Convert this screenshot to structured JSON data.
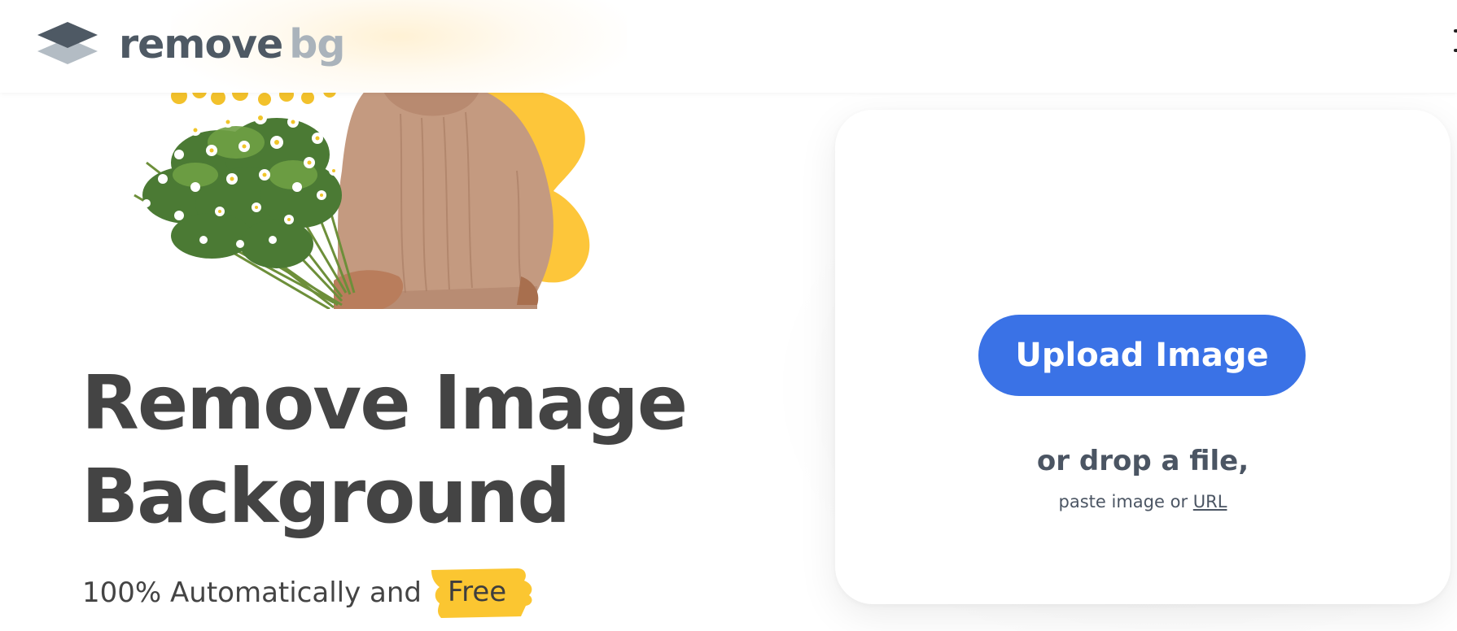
{
  "header": {
    "logo": {
      "word_primary": "remove",
      "word_secondary": "bg"
    }
  },
  "hero": {
    "headline_line1": "Remove Image",
    "headline_line2": "Background",
    "subline": "100% Automatically and",
    "highlight": "Free"
  },
  "upload": {
    "button_label": "Upload Image",
    "drop_text": "or drop a file,",
    "paste_prefix": "paste image or",
    "url_link": "URL"
  },
  "icons": [
    "removebg-logo-icon",
    "menu-icon"
  ],
  "colors": {
    "primary_button": "#3a72e6",
    "headline_text": "#444444",
    "logo_primary": "#4e5964",
    "logo_secondary": "#aab3bb",
    "highlight_yellow": "#fbc631",
    "flower_yellow": "#fdc63a"
  }
}
